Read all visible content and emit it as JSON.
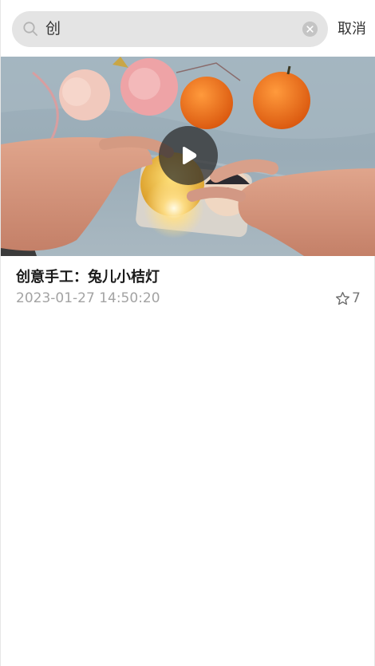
{
  "search": {
    "query": "创",
    "cancel_label": "取消"
  },
  "results": [
    {
      "title": "创意手工：兔儿小桔灯",
      "date": "2023-01-27 14:50:20",
      "favorites": "7"
    }
  ],
  "icons": {
    "search": "search-icon",
    "clear": "clear-icon",
    "play": "play-icon",
    "favorite": "star-outline-icon"
  },
  "colors": {
    "search_background": "#e4e4e4",
    "meta_text": "#a3a3a3",
    "title_text": "#1a1a1a"
  }
}
